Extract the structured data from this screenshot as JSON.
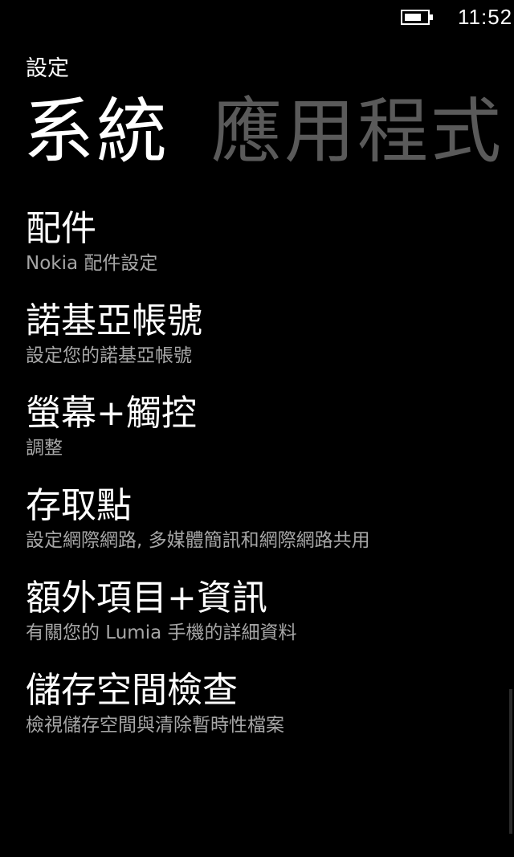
{
  "status_bar": {
    "time": "11:52",
    "battery_level": 0.75,
    "battery_icon": "battery-icon"
  },
  "header": {
    "app_title": "設定"
  },
  "pivot": {
    "tabs": [
      {
        "label": "系統",
        "active": true
      },
      {
        "label": "應用程式",
        "active": false
      }
    ]
  },
  "settings": {
    "items": [
      {
        "title": "配件",
        "subtitle": "Nokia 配件設定"
      },
      {
        "title": "諾基亞帳號",
        "subtitle": "設定您的諾基亞帳號"
      },
      {
        "title": "螢幕+觸控",
        "subtitle": "調整"
      },
      {
        "title": "存取點",
        "subtitle": "設定網際網路, 多媒體簡訊和網際網路共用"
      },
      {
        "title": "額外項目+資訊",
        "subtitle": "有關您的 Lumia 手機的詳細資料"
      },
      {
        "title": "儲存空間檢查",
        "subtitle": "檢視儲存空間與清除暫時性檔案"
      }
    ]
  },
  "colors": {
    "background": "#000000",
    "foreground": "#ffffff",
    "subtle_text": "#a6a6a6",
    "inactive_pivot": "#5a5a5a"
  }
}
